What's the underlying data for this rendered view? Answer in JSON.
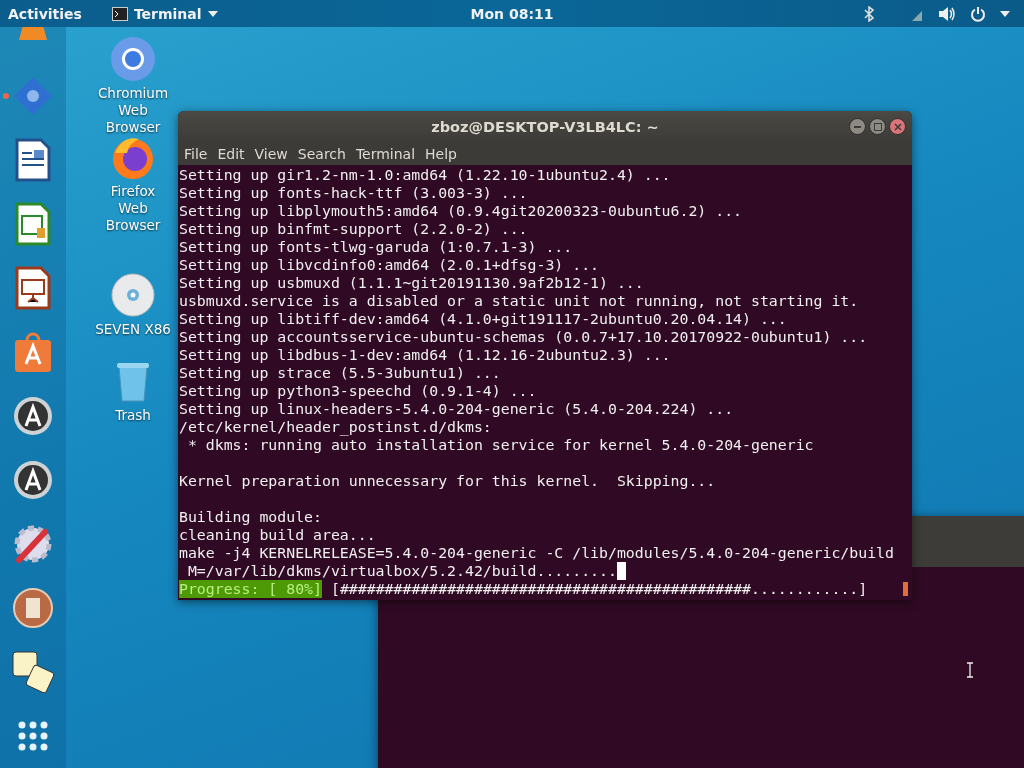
{
  "top_bar": {
    "activities": "Activities",
    "app_menu": "Terminal",
    "clock": "Mon 08:11"
  },
  "dock": [
    {
      "running": false
    },
    {
      "running": true
    },
    {
      "running": false
    },
    {
      "running": false
    },
    {
      "running": false
    },
    {
      "running": false
    },
    {
      "running": false
    },
    {
      "running": false
    },
    {
      "running": false
    },
    {
      "running": false
    },
    {
      "running": false
    }
  ],
  "desktop_icons": [
    {
      "label": "Chromium Web Browser"
    },
    {
      "label": "Firefox Web Browser"
    },
    {
      "label": "SEVEN X86"
    },
    {
      "label": "Trash"
    }
  ],
  "terminal": {
    "title": "zboz@DESKTOP-V3LB4LC: ~",
    "menu": [
      "File",
      "Edit",
      "View",
      "Search",
      "Terminal",
      "Help"
    ],
    "lines": [
      {
        "kind": "text",
        "text": "Setting up gir1.2-nm-1.0:amd64 (1.22.10-1ubuntu2.4) ..."
      },
      {
        "kind": "text",
        "text": "Setting up fonts-hack-ttf (3.003-3) ..."
      },
      {
        "kind": "text",
        "text": "Setting up libplymouth5:amd64 (0.9.4git20200323-0ubuntu6.2) ..."
      },
      {
        "kind": "text",
        "text": "Setting up binfmt-support (2.2.0-2) ..."
      },
      {
        "kind": "text",
        "text": "Setting up fonts-tlwg-garuda (1:0.7.1-3) ..."
      },
      {
        "kind": "text",
        "text": "Setting up libvcdinfo0:amd64 (2.0.1+dfsg-3) ..."
      },
      {
        "kind": "text",
        "text": "Setting up usbmuxd (1.1.1~git20191130.9af2b12-1) ..."
      },
      {
        "kind": "text",
        "text": "usbmuxd.service is a disabled or a static unit not running, not starting it."
      },
      {
        "kind": "text",
        "text": "Setting up libtiff-dev:amd64 (4.1.0+git191117-2ubuntu0.20.04.14) ..."
      },
      {
        "kind": "text",
        "text": "Setting up accountsservice-ubuntu-schemas (0.0.7+17.10.20170922-0ubuntu1) ..."
      },
      {
        "kind": "text",
        "text": "Setting up libdbus-1-dev:amd64 (1.12.16-2ubuntu2.3) ..."
      },
      {
        "kind": "text",
        "text": "Setting up strace (5.5-3ubuntu1) ..."
      },
      {
        "kind": "text",
        "text": "Setting up python3-speechd (0.9.1-4) ..."
      },
      {
        "kind": "text",
        "text": "Setting up linux-headers-5.4.0-204-generic (5.4.0-204.224) ..."
      },
      {
        "kind": "text",
        "text": "/etc/kernel/header_postinst.d/dkms:"
      },
      {
        "kind": "text",
        "text": " * dkms: running auto installation service for kernel 5.4.0-204-generic"
      },
      {
        "kind": "blank"
      },
      {
        "kind": "text",
        "text": "Kernel preparation unnecessary for this kernel.  Skipping..."
      },
      {
        "kind": "blank"
      },
      {
        "kind": "text",
        "text": "Building module:"
      },
      {
        "kind": "text",
        "text": "cleaning build area..."
      },
      {
        "kind": "text",
        "text": "make -j4 KERNELRELEASE=5.4.0-204-generic -C /lib/modules/5.4.0-204-generic/build"
      },
      {
        "kind": "prompt",
        "text": " M=/var/lib/dkms/virtualbox/5.2.42/build........."
      }
    ],
    "progress_label": "Progress: [ 80%]",
    "progress_bar": "[##############################################............]"
  }
}
